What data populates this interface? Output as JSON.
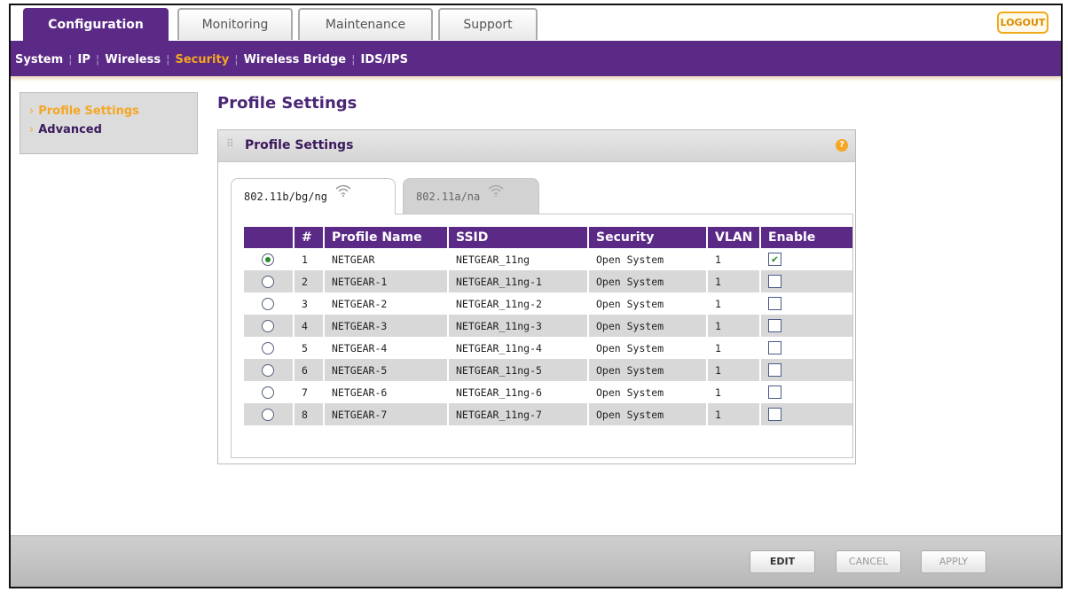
{
  "main_tabs": [
    {
      "label": "Configuration"
    },
    {
      "label": "Monitoring"
    },
    {
      "label": "Maintenance"
    },
    {
      "label": "Support"
    }
  ],
  "logout_label": "LOGOUT",
  "subnav": [
    {
      "label": "System"
    },
    {
      "label": "IP"
    },
    {
      "label": "Wireless"
    },
    {
      "label": "Security"
    },
    {
      "label": "Wireless Bridge"
    },
    {
      "label": "IDS/IPS"
    }
  ],
  "sidemenu": [
    {
      "label": "Profile Settings"
    },
    {
      "label": "Advanced"
    }
  ],
  "page_title": "Profile Settings",
  "panel": {
    "title": "Profile Settings",
    "help": "?",
    "radio_tabs": [
      {
        "label": "802.11b/bg/ng"
      },
      {
        "label": "802.11a/na"
      }
    ]
  },
  "table": {
    "headers": [
      "",
      "#",
      "Profile Name",
      "SSID",
      "Security",
      "VLAN",
      "Enable"
    ],
    "rows": [
      {
        "num": "1",
        "name": "NETGEAR",
        "ssid": "NETGEAR_11ng",
        "security": "Open System",
        "vlan": "1",
        "enabled": true,
        "selected": true
      },
      {
        "num": "2",
        "name": "NETGEAR-1",
        "ssid": "NETGEAR_11ng-1",
        "security": "Open System",
        "vlan": "1",
        "enabled": false,
        "selected": false
      },
      {
        "num": "3",
        "name": "NETGEAR-2",
        "ssid": "NETGEAR_11ng-2",
        "security": "Open System",
        "vlan": "1",
        "enabled": false,
        "selected": false
      },
      {
        "num": "4",
        "name": "NETGEAR-3",
        "ssid": "NETGEAR_11ng-3",
        "security": "Open System",
        "vlan": "1",
        "enabled": false,
        "selected": false
      },
      {
        "num": "5",
        "name": "NETGEAR-4",
        "ssid": "NETGEAR_11ng-4",
        "security": "Open System",
        "vlan": "1",
        "enabled": false,
        "selected": false
      },
      {
        "num": "6",
        "name": "NETGEAR-5",
        "ssid": "NETGEAR_11ng-5",
        "security": "Open System",
        "vlan": "1",
        "enabled": false,
        "selected": false
      },
      {
        "num": "7",
        "name": "NETGEAR-6",
        "ssid": "NETGEAR_11ng-6",
        "security": "Open System",
        "vlan": "1",
        "enabled": false,
        "selected": false
      },
      {
        "num": "8",
        "name": "NETGEAR-7",
        "ssid": "NETGEAR_11ng-7",
        "security": "Open System",
        "vlan": "1",
        "enabled": false,
        "selected": false
      }
    ]
  },
  "footer": {
    "edit": "EDIT",
    "cancel": "CANCEL",
    "apply": "APPLY"
  },
  "colors": {
    "brand_purple": "#5b2a86",
    "accent_orange": "#f5a623"
  }
}
